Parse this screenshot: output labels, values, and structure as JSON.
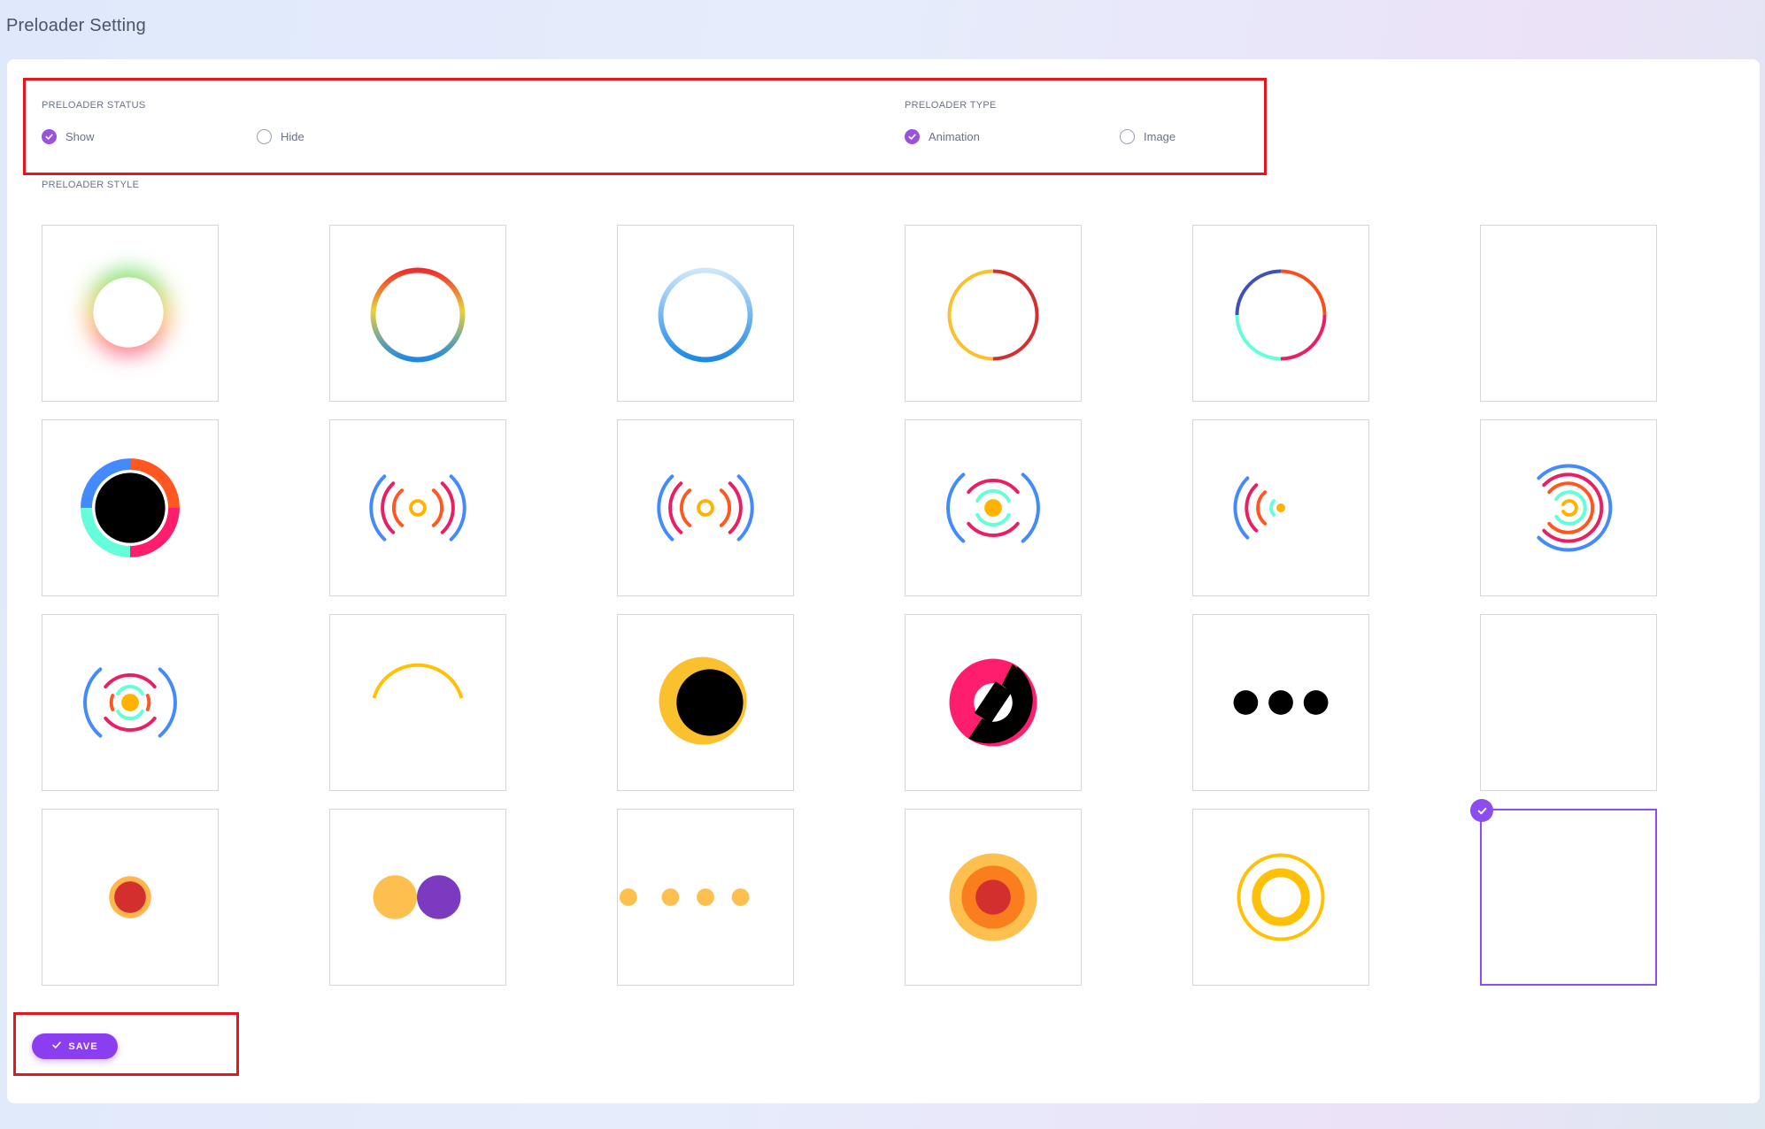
{
  "page": {
    "title": "Preloader Setting"
  },
  "status": {
    "label": "PRELOADER STATUS",
    "options": [
      {
        "label": "Show",
        "checked": true
      },
      {
        "label": "Hide",
        "checked": false
      }
    ]
  },
  "type": {
    "label": "PRELOADER TYPE",
    "options": [
      {
        "label": "Animation",
        "checked": true
      },
      {
        "label": "Image",
        "checked": false
      }
    ]
  },
  "style": {
    "label": "PRELOADER STYLE",
    "selected_index": 23,
    "tiles": [
      "glow-ring",
      "gradient-ring",
      "blue-ring",
      "split-ring",
      "gradient-ring-2",
      "blank",
      "quad-ring",
      "signal-waves",
      "signal-waves-2",
      "target-arcs",
      "partial-waves",
      "concentric-arcs",
      "target-arcs-2",
      "arc",
      "eclipse",
      "pink-black-disc",
      "three-dots",
      "blank",
      "pulse-dot",
      "two-balls",
      "four-dots",
      "orange-rings",
      "yellow-rings",
      "blank"
    ]
  },
  "save": {
    "label": "SAVE"
  },
  "colors": {
    "accent": "#8b3df0",
    "highlight": "#e8141d",
    "tile_border": "#d6d6d6"
  }
}
